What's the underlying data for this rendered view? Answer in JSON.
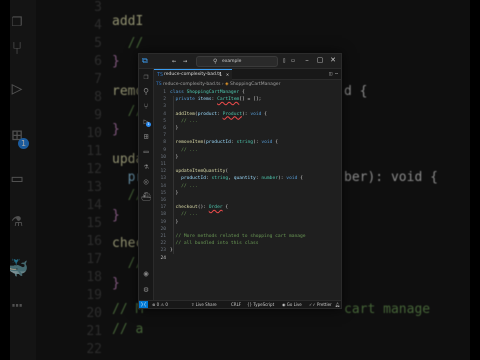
{
  "background": {
    "line_numbers": [
      "3",
      "4",
      "5",
      "6",
      "7",
      "8",
      "9",
      "10",
      "11",
      "12",
      "13",
      "14",
      "15",
      "16",
      "17",
      "18",
      "19",
      "20",
      "21",
      "22"
    ],
    "code_lines": [
      "addI",
      "  //",
      "}",
      "remo",
      "  //",
      "}",
      "upda",
      "  pro",
      "  //",
      "}",
      "chec",
      "  //",
      "}",
      "// M",
      "// a"
    ],
    "right_fragments": [
      "d {",
      "ber): void {",
      "cart manage"
    ],
    "badge": "1"
  },
  "titlebar": {
    "search_text": "example",
    "logo_icon": "vscode-logo-icon"
  },
  "activity": {
    "badge": "1",
    "icons": [
      "files-icon",
      "search-icon",
      "source-control-icon",
      "run-debug-icon",
      "extensions-icon",
      "remote-explorer-icon",
      "testing-icon",
      "database-icon",
      "docker-icon",
      "accounts-icon",
      "settings-icon"
    ]
  },
  "tab": {
    "label": "reduce-complexity-bad.ts",
    "modified": "1"
  },
  "breadcrumb": {
    "file": "reduce-complexity-bad.ts",
    "symbol": "ShoppingCartManager"
  },
  "editor": {
    "line_numbers": [
      "1",
      "2",
      "3",
      "4",
      "5",
      "6",
      "7",
      "8",
      "9",
      "10",
      "11",
      "12",
      "13",
      "14",
      "15",
      "16",
      "17",
      "18",
      "19",
      "20",
      "21",
      "22",
      "23",
      "24"
    ],
    "active_line": "24"
  },
  "statusbar": {
    "errors": "0",
    "warnings": "0",
    "live_share": "Live Share",
    "eol": "CRLF",
    "language": "TypeScript",
    "go_live": "Go Live",
    "prettier": "Prettier"
  }
}
